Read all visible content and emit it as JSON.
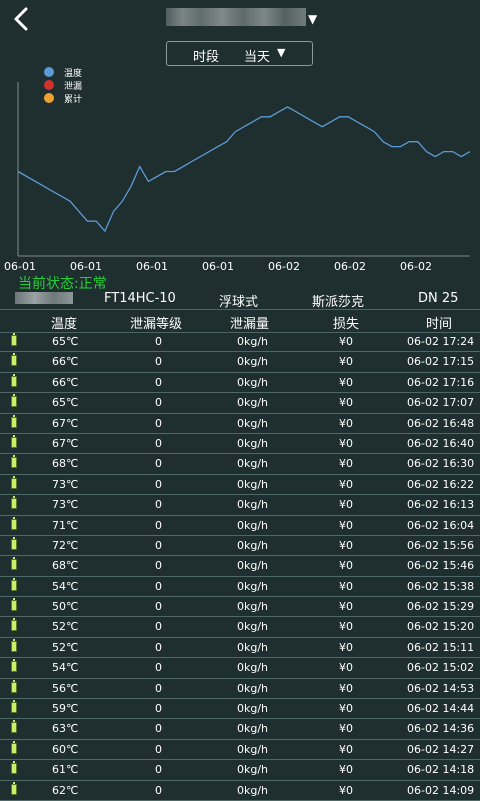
{
  "header": {
    "title": "",
    "period_label": "时段",
    "period_value": "当天"
  },
  "chart_data": {
    "type": "line",
    "legend": [
      {
        "name": "温度",
        "color": "#5b9bd5"
      },
      {
        "name": "泄漏",
        "color": "#d2322d"
      },
      {
        "name": "累计",
        "color": "#f0a030"
      }
    ],
    "x_ticks": [
      "06-01",
      "06-01",
      "06-01",
      "06-01",
      "06-02",
      "06-02",
      "06-02"
    ],
    "legend_position": "top-left",
    "series": [
      {
        "name": "温度",
        "color": "#5b9bd5",
        "values": [
          62,
          61,
          60,
          59,
          58,
          57,
          56,
          54,
          52,
          52,
          50,
          54,
          56,
          59,
          63,
          60,
          61,
          62,
          62,
          63,
          64,
          65,
          66,
          67,
          68,
          70,
          71,
          72,
          73,
          73,
          74,
          75,
          74,
          73,
          72,
          71,
          72,
          73,
          73,
          72,
          71,
          70,
          68,
          67,
          67,
          68,
          68,
          66,
          65,
          66,
          66,
          65,
          66
        ]
      }
    ]
  },
  "status_text": "当前状态:正常",
  "device": {
    "name": "",
    "model": "FT14HC-10",
    "type": "浮球式",
    "brand": "斯派莎克",
    "size": "DN 25"
  },
  "table": {
    "headers": [
      "温度",
      "泄漏等级",
      "泄漏量",
      "损失",
      "时间"
    ],
    "rows": [
      {
        "temp": "65℃",
        "level": "0",
        "amount": "0kg/h",
        "loss": "¥0",
        "time": "06-02 17:24"
      },
      {
        "temp": "66℃",
        "level": "0",
        "amount": "0kg/h",
        "loss": "¥0",
        "time": "06-02 17:15"
      },
      {
        "temp": "66℃",
        "level": "0",
        "amount": "0kg/h",
        "loss": "¥0",
        "time": "06-02 17:16"
      },
      {
        "temp": "65℃",
        "level": "0",
        "amount": "0kg/h",
        "loss": "¥0",
        "time": "06-02 17:07"
      },
      {
        "temp": "67℃",
        "level": "0",
        "amount": "0kg/h",
        "loss": "¥0",
        "time": "06-02 16:48"
      },
      {
        "temp": "67℃",
        "level": "0",
        "amount": "0kg/h",
        "loss": "¥0",
        "time": "06-02 16:40"
      },
      {
        "temp": "68℃",
        "level": "0",
        "amount": "0kg/h",
        "loss": "¥0",
        "time": "06-02 16:30"
      },
      {
        "temp": "73℃",
        "level": "0",
        "amount": "0kg/h",
        "loss": "¥0",
        "time": "06-02 16:22"
      },
      {
        "temp": "73℃",
        "level": "0",
        "amount": "0kg/h",
        "loss": "¥0",
        "time": "06-02 16:13"
      },
      {
        "temp": "71℃",
        "level": "0",
        "amount": "0kg/h",
        "loss": "¥0",
        "time": "06-02 16:04"
      },
      {
        "temp": "72℃",
        "level": "0",
        "amount": "0kg/h",
        "loss": "¥0",
        "time": "06-02 15:56"
      },
      {
        "temp": "68℃",
        "level": "0",
        "amount": "0kg/h",
        "loss": "¥0",
        "time": "06-02 15:46"
      },
      {
        "temp": "54℃",
        "level": "0",
        "amount": "0kg/h",
        "loss": "¥0",
        "time": "06-02 15:38"
      },
      {
        "temp": "50℃",
        "level": "0",
        "amount": "0kg/h",
        "loss": "¥0",
        "time": "06-02 15:29"
      },
      {
        "temp": "52℃",
        "level": "0",
        "amount": "0kg/h",
        "loss": "¥0",
        "time": "06-02 15:20"
      },
      {
        "temp": "52℃",
        "level": "0",
        "amount": "0kg/h",
        "loss": "¥0",
        "time": "06-02 15:11"
      },
      {
        "temp": "54℃",
        "level": "0",
        "amount": "0kg/h",
        "loss": "¥0",
        "time": "06-02 15:02"
      },
      {
        "temp": "56℃",
        "level": "0",
        "amount": "0kg/h",
        "loss": "¥0",
        "time": "06-02 14:53"
      },
      {
        "temp": "59℃",
        "level": "0",
        "amount": "0kg/h",
        "loss": "¥0",
        "time": "06-02 14:44"
      },
      {
        "temp": "63℃",
        "level": "0",
        "amount": "0kg/h",
        "loss": "¥0",
        "time": "06-02 14:36"
      },
      {
        "temp": "60℃",
        "level": "0",
        "amount": "0kg/h",
        "loss": "¥0",
        "time": "06-02 14:27"
      },
      {
        "temp": "61℃",
        "level": "0",
        "amount": "0kg/h",
        "loss": "¥0",
        "time": "06-02 14:18"
      },
      {
        "temp": "62℃",
        "level": "0",
        "amount": "0kg/h",
        "loss": "¥0",
        "time": "06-02 14:09"
      }
    ]
  }
}
